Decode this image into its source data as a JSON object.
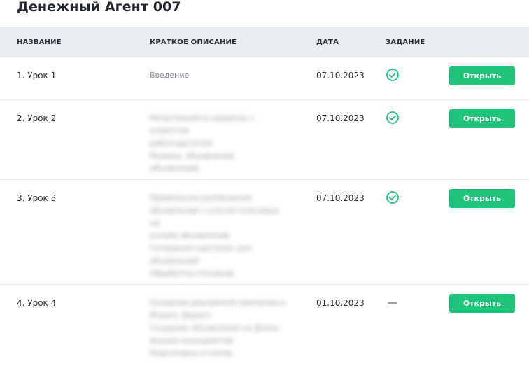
{
  "page": {
    "title": "Денежный Агент 007"
  },
  "table": {
    "headers": {
      "name": "НАЗВАНИЕ",
      "description": "КРАТКОЕ ОПИСАНИЕ",
      "date": "ДАТА",
      "task": "ЗАДАНИЕ"
    },
    "rows": [
      {
        "name": "1. Урок 1",
        "description": "Введение",
        "date": "07.10.2023",
        "task_status": "completed",
        "button_label": "Открыть"
      },
      {
        "name": "2. Урок 2",
        "description_blurred": [
          "Регистрация в сервисах с клиентом",
          "работодателем",
          "Размещ. объявления",
          "объявлений"
        ],
        "date": "07.10.2023",
        "task_status": "completed",
        "button_label": "Открыть"
      },
      {
        "name": "3. Урок 3",
        "description_blurred": [
          "Правильное размещение",
          "объявлений с учетом ключевых на",
          "основе объявлений",
          "Генерация картинок для",
          "объявлений",
          "Обработка откликов"
        ],
        "date": "07.10.2023",
        "task_status": "completed",
        "button_label": "Открыть"
      },
      {
        "name": "4. Урок 4",
        "description_blurred": [
          "Создание рекламной кампании в",
          "Яндекс Директ",
          "Создание объявления на Дзене.",
          "Анализ конкурентов",
          "Подготовка отчетов"
        ],
        "date": "01.10.2023",
        "task_status": "none",
        "button_label": "Открыть"
      }
    ]
  },
  "colors": {
    "accent_green": "#1dc47a",
    "header_bg": "#e8ecf1"
  },
  "icons": {
    "completed": "check-circle-icon",
    "none": "dash-icon"
  }
}
